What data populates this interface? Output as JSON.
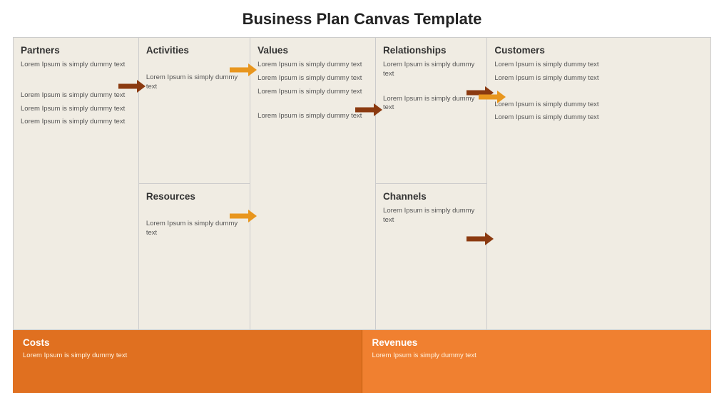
{
  "title": "Business Plan Canvas Template",
  "dummy": "Lorem Ipsum is simply dummy text",
  "sections": {
    "partners": {
      "header": "Partners",
      "items": [
        "Lorem Ipsum is simply dummy text",
        "Lorem Ipsum is simply dummy text",
        "Lorem Ipsum is simply dummy text",
        "Lorem Ipsum is simply dummy text"
      ]
    },
    "activities": {
      "header": "Activities",
      "items": [
        "Lorem Ipsum is simply dummy text"
      ]
    },
    "resources": {
      "header": "Resources",
      "items": [
        "Lorem Ipsum is simply dummy text"
      ]
    },
    "values": {
      "header": "Values",
      "items": [
        "Lorem Ipsum is simply dummy text",
        "Lorem Ipsum is simply dummy text",
        "Lorem Ipsum is simply dummy text",
        "Lorem Ipsum is simply dummy text"
      ]
    },
    "relationships": {
      "header": "Relationships",
      "items": [
        "Lorem Ipsum is simply dummy text",
        "Lorem Ipsum is simply dummy text"
      ]
    },
    "channels": {
      "header": "Channels",
      "items": [
        "Lorem Ipsum is simply dummy text"
      ]
    },
    "customers": {
      "header": "Customers",
      "items": [
        "Lorem Ipsum is simply dummy text",
        "Lorem Ipsum is simply dummy text",
        "Lorem Ipsum is simply dummy text",
        "Lorem Ipsum is simply dummy text"
      ]
    },
    "costs": {
      "header": "Costs",
      "items": [
        "Lorem Ipsum is simply dummy text"
      ]
    },
    "revenues": {
      "header": "Revenues",
      "items": [
        "Lorem Ipsum is simply dummy text"
      ]
    }
  }
}
